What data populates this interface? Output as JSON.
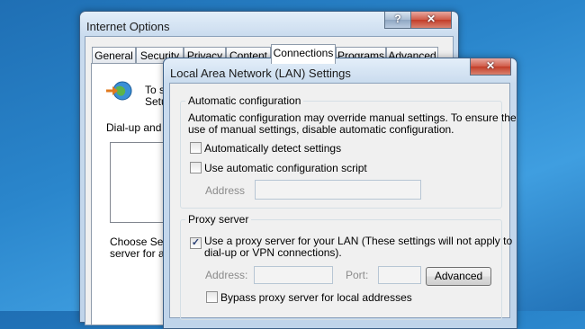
{
  "internet_options": {
    "title": "Internet Options",
    "help_label": "?",
    "close_label": "✕",
    "tabs": [
      "General",
      "Security",
      "Privacy",
      "Content",
      "Connections",
      "Programs",
      "Advanced"
    ],
    "active_tab": "Connections",
    "setup_text_line1": "To s",
    "setup_text_line2": "Setu",
    "dialup_label": "Dial-up and V",
    "choose_text_line1": "Choose Setti",
    "choose_text_line2": "server for a"
  },
  "lan_dialog": {
    "title": "Local Area Network (LAN) Settings",
    "close_label": "✕",
    "auto_config": {
      "legend": "Automatic configuration",
      "description_line1": "Automatic configuration may override manual settings.  To ensure the",
      "description_line2": "use of manual settings, disable automatic configuration.",
      "detect_label": "Automatically detect settings",
      "detect_checked": false,
      "script_label": "Use automatic configuration script",
      "script_checked": false,
      "address_label": "Address",
      "address_value": ""
    },
    "proxy": {
      "legend": "Proxy server",
      "use_proxy_label_line1": "Use a proxy server for your LAN (These settings will not apply to",
      "use_proxy_label_line2": "dial-up or VPN connections).",
      "use_proxy_checked": true,
      "address_label": "Address:",
      "address_value": "",
      "port_label": "Port:",
      "port_value": "",
      "advanced_label": "Advanced",
      "bypass_label": "Bypass proxy server for local addresses",
      "bypass_checked": false
    }
  }
}
